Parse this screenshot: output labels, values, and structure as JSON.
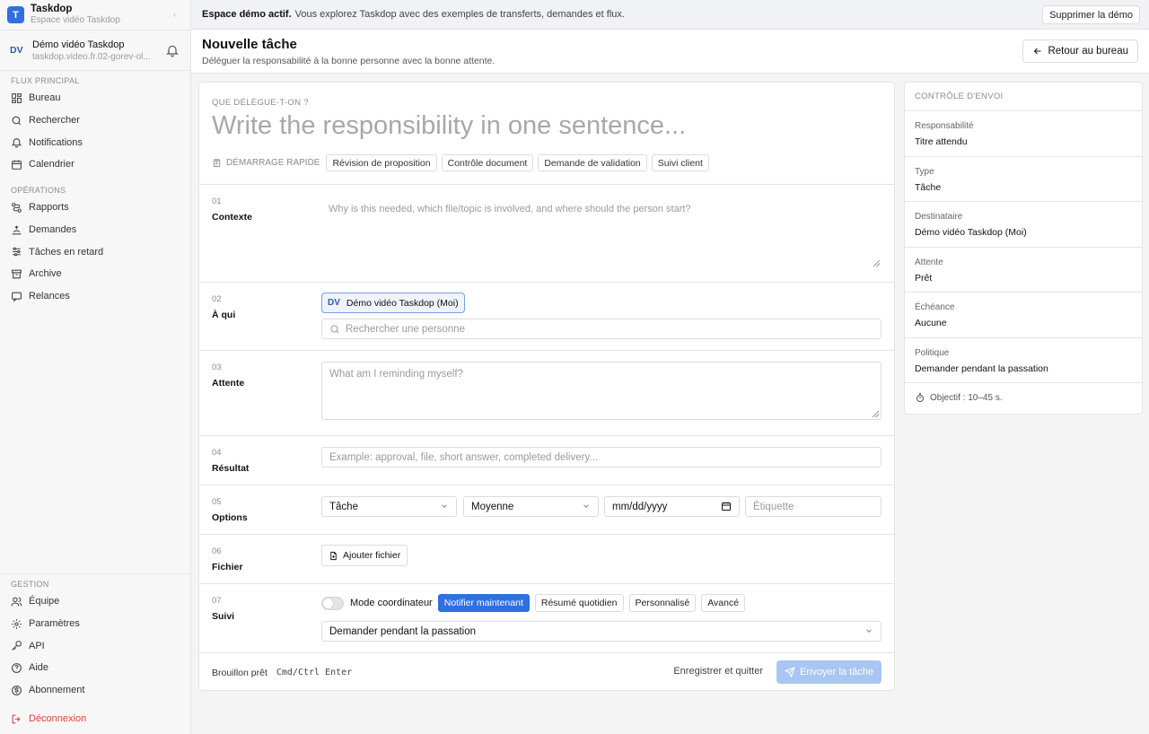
{
  "brand": {
    "name": "Taskdop",
    "subtitle": "Espace vidéo Taskdop",
    "initial": "T"
  },
  "user": {
    "initials": "DV",
    "name": "Démo vidéo Taskdop",
    "url": "taskdop.video.fr.02-gorev-ol..."
  },
  "sidebar": {
    "sections": [
      {
        "label": "Flux principal",
        "items": [
          {
            "label": "Bureau",
            "icon": "dashboard-icon"
          },
          {
            "label": "Rechercher",
            "icon": "search-icon"
          },
          {
            "label": "Notifications",
            "icon": "bell-icon"
          },
          {
            "label": "Calendrier",
            "icon": "calendar-icon"
          }
        ]
      },
      {
        "label": "Opérations",
        "items": [
          {
            "label": "Rapports",
            "icon": "route-icon"
          },
          {
            "label": "Demandes",
            "icon": "hand-icon"
          },
          {
            "label": "Tâches en retard",
            "icon": "sliders-icon"
          },
          {
            "label": "Archive",
            "icon": "archive-icon"
          },
          {
            "label": "Relances",
            "icon": "message-icon"
          }
        ]
      },
      {
        "label": "Gestion",
        "items": [
          {
            "label": "Équipe",
            "icon": "users-icon"
          },
          {
            "label": "Paramètres",
            "icon": "gear-icon"
          },
          {
            "label": "API",
            "icon": "key-icon"
          },
          {
            "label": "Aide",
            "icon": "help-icon"
          },
          {
            "label": "Abonnement",
            "icon": "dollar-icon"
          }
        ]
      }
    ],
    "logout": "Déconnexion"
  },
  "banner": {
    "bold": "Espace démo actif.",
    "text": "Vous explorez Taskdop avec des exemples de transferts, demandes et flux.",
    "button": "Supprimer la démo"
  },
  "header": {
    "title": "Nouvelle tâche",
    "subtitle": "Déléguer la responsabilité à la bonne personne avec la bonne attente.",
    "back_button": "Retour au bureau"
  },
  "form": {
    "question_label": "Que délègue-t-on ?",
    "title_placeholder": "Write the responsibility in one sentence...",
    "quick_start_label": "Démarrage rapide",
    "quick_chips": [
      "Révision de proposition",
      "Contrôle document",
      "Demande de validation",
      "Suivi client"
    ],
    "rows": {
      "context": {
        "num": "01",
        "label": "Contexte",
        "placeholder": "Why is this needed, which file/topic is involved, and where should the person start?"
      },
      "who": {
        "num": "02",
        "label": "À qui",
        "selected_initials": "DV",
        "selected_name": "Démo vidéo Taskdop (Moi)",
        "search_placeholder": "Rechercher une personne"
      },
      "expect": {
        "num": "03",
        "label": "Attente",
        "placeholder": "What am I reminding myself?"
      },
      "result": {
        "num": "04",
        "label": "Résultat",
        "placeholder": "Example: approval, file, short answer, completed delivery..."
      },
      "options": {
        "num": "05",
        "label": "Options",
        "type": "Tâche",
        "priority": "Moyenne",
        "date_placeholder": "mm/dd/yyyy",
        "tag_placeholder": "Étiquette"
      },
      "file": {
        "num": "06",
        "label": "Fichier",
        "button": "Ajouter fichier"
      },
      "follow": {
        "num": "07",
        "label": "Suivi",
        "coordinator": "Mode coordinateur",
        "coordinator_on": false,
        "modes": [
          "Notifier maintenant",
          "Résumé quotidien",
          "Personnalisé",
          "Avancé"
        ],
        "active_mode": "Notifier maintenant",
        "policy": "Demander pendant la passation"
      }
    },
    "footer": {
      "draft": "Brouillon prêt",
      "shortcut": "Cmd/Ctrl Enter",
      "save_quit": "Enregistrer et quitter",
      "send": "Envoyer la tâche"
    }
  },
  "panel": {
    "title": "Contrôle d'envoi",
    "rows": [
      {
        "label": "Responsabilité",
        "value": "Titre attendu"
      },
      {
        "label": "Type",
        "value": "Tâche"
      },
      {
        "label": "Destinataire",
        "value": "Démo vidéo Taskdop (Moi)"
      },
      {
        "label": "Attente",
        "value": "Prêt"
      },
      {
        "label": "Échéance",
        "value": "Aucune"
      },
      {
        "label": "Politique",
        "value": "Demander pendant la passation"
      }
    ],
    "goal": "Objectif : 10–45 s."
  },
  "colors": {
    "accent": "#2f6fde",
    "send_disabled": "#a9c6f2",
    "logout": "#d9453a"
  }
}
